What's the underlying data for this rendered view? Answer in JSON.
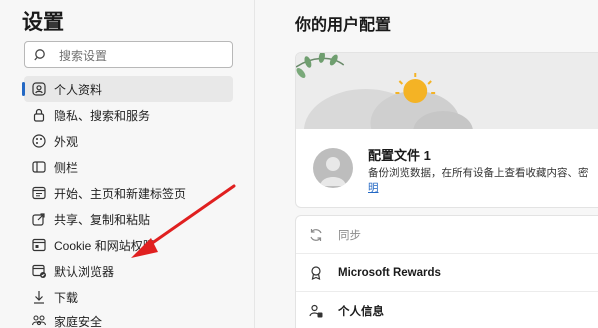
{
  "sidebar": {
    "title": "设置",
    "search": {
      "placeholder": "搜索设置",
      "icon": "search-icon"
    },
    "items": [
      {
        "label": "个人资料",
        "icon": "profile-icon",
        "active": true
      },
      {
        "label": "隐私、搜索和服务",
        "icon": "lock-icon",
        "active": false
      },
      {
        "label": "外观",
        "icon": "appearance-icon",
        "active": false
      },
      {
        "label": "侧栏",
        "icon": "sidebar-icon",
        "active": false
      },
      {
        "label": "开始、主页和新建标签页",
        "icon": "home-icon",
        "active": false
      },
      {
        "label": "共享、复制和粘贴",
        "icon": "share-icon",
        "active": false
      },
      {
        "label": "Cookie 和网站权限",
        "icon": "cookie-icon",
        "active": false
      },
      {
        "label": "默认浏览器",
        "icon": "browser-icon",
        "active": false
      },
      {
        "label": "下载",
        "icon": "download-icon",
        "active": false
      },
      {
        "label": "家庭安全",
        "icon": "family-icon",
        "active": false
      }
    ],
    "active_color": "#2368c4"
  },
  "annotation": {
    "color": "#e02020",
    "points_to": "默认浏览器"
  },
  "main": {
    "title": "你的用户配置",
    "profile": {
      "name": "配置文件 1",
      "description": "备份浏览数据，在所有设备上查看收藏内容、密",
      "link_text": "明"
    },
    "rows": [
      {
        "label": "同步",
        "icon": "sync-icon",
        "style": "muted"
      },
      {
        "label": "Microsoft Rewards",
        "icon": "rewards-icon",
        "style": "bold"
      },
      {
        "label": "个人信息",
        "icon": "personal-info-icon",
        "style": "bold"
      }
    ]
  }
}
